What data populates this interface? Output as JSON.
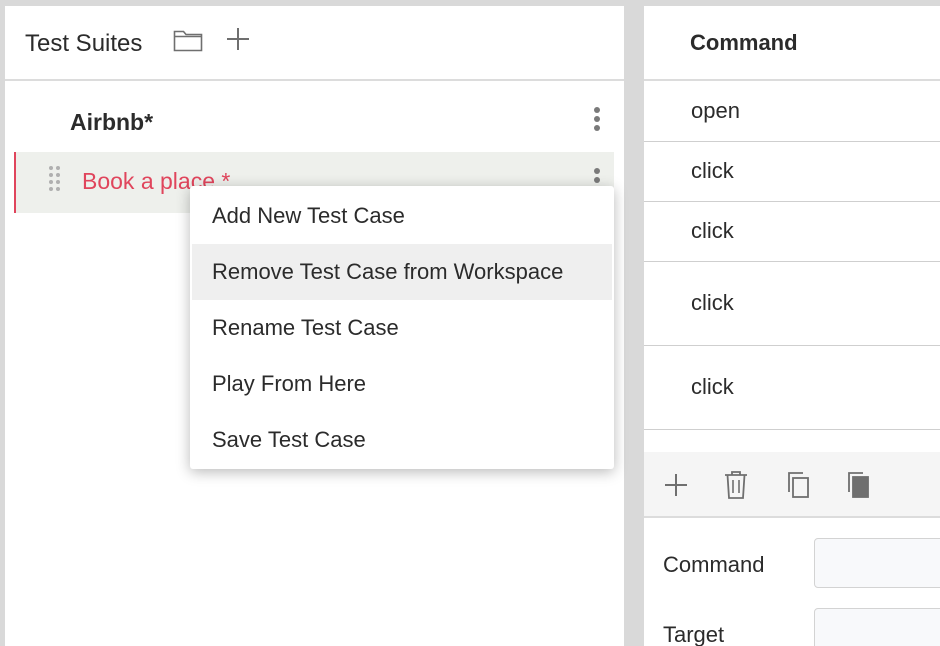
{
  "left_panel": {
    "title": "Test Suites",
    "header_icons": [
      "folder-icon",
      "plus-icon"
    ],
    "suite": {
      "name": "Airbnb*"
    },
    "test_case": {
      "name": "Book a place *"
    }
  },
  "context_menu": {
    "items": [
      {
        "label": "Add New Test Case"
      },
      {
        "label": "Remove Test Case from Workspace",
        "highlighted": true
      },
      {
        "label": "Rename Test Case"
      },
      {
        "label": "Play From Here"
      },
      {
        "label": "Save Test Case"
      }
    ]
  },
  "right_panel": {
    "column_title": "Command",
    "commands": [
      "open",
      "click",
      "click",
      "click",
      "click"
    ],
    "toolbar_icons": [
      "plus-icon",
      "trash-icon",
      "copy-icon",
      "paste-icon"
    ],
    "fields": [
      {
        "label": "Command",
        "value": ""
      },
      {
        "label": "Target",
        "value": ""
      }
    ]
  },
  "colors": {
    "accent": "#e0455c",
    "selected_row_bg": "#eef0ec",
    "menu_hover_bg": "#efefef",
    "page_bg": "#d9d9d9"
  }
}
